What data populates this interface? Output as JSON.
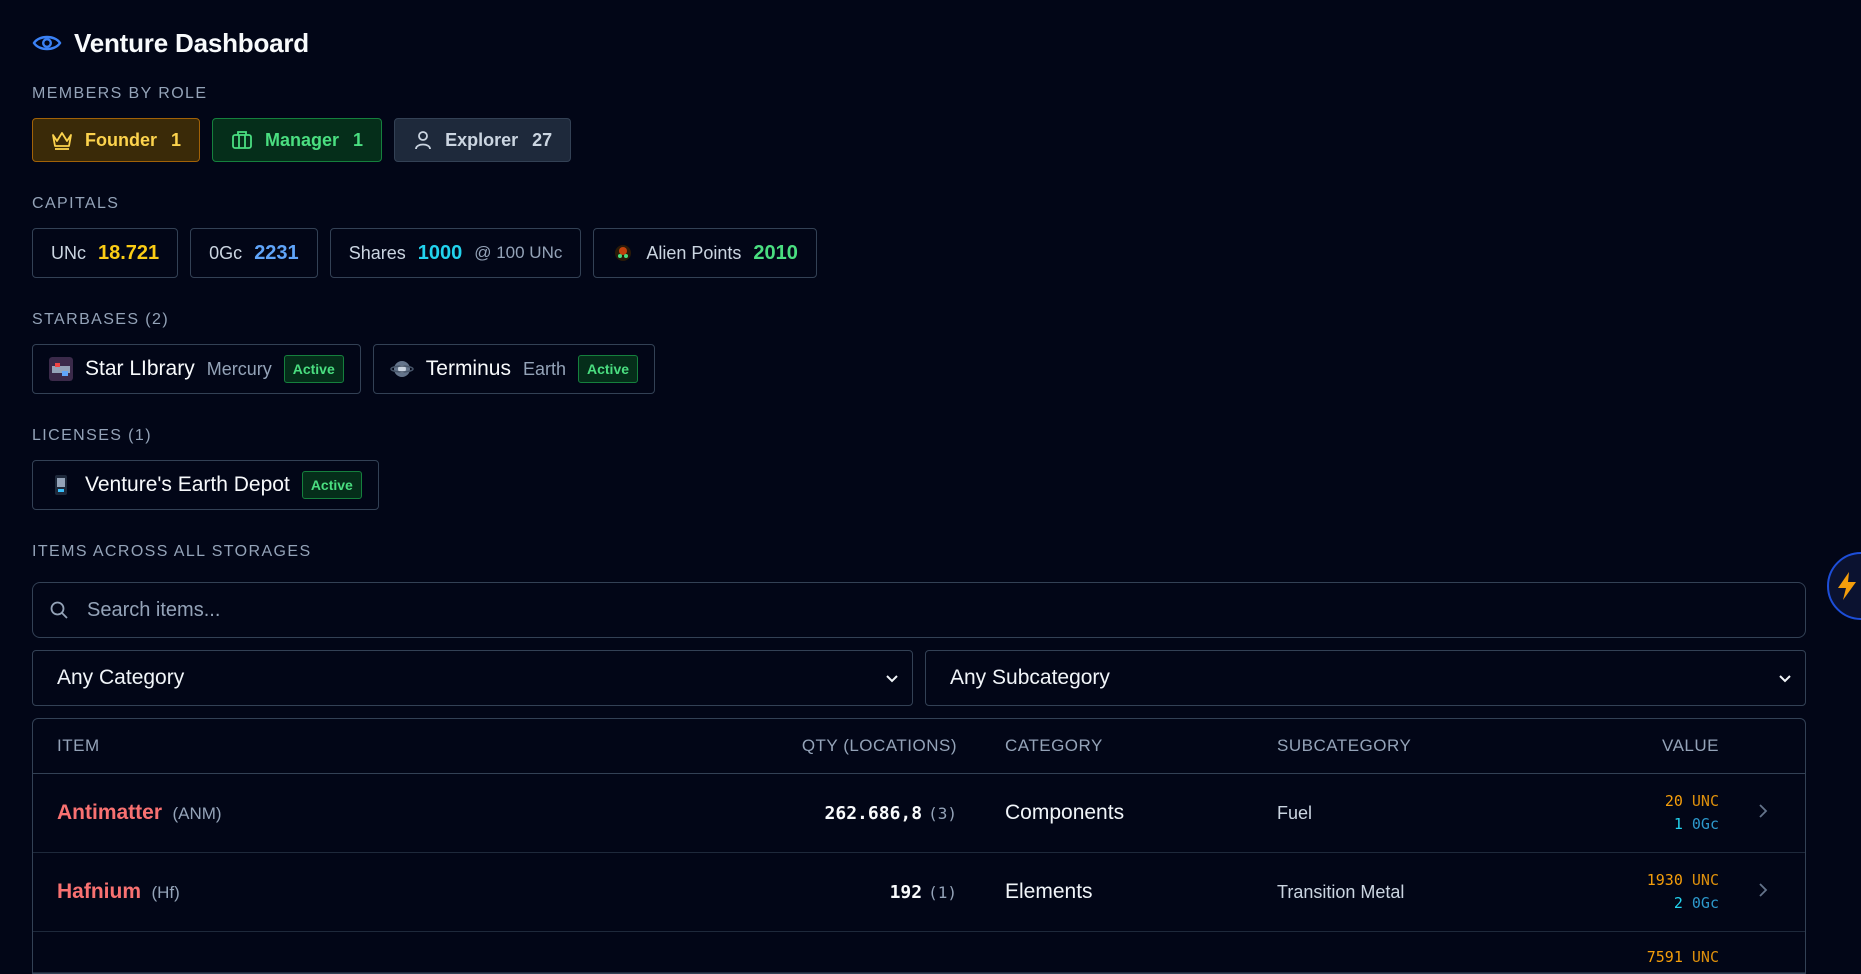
{
  "header": {
    "title": "Venture Dashboard",
    "icon": "eye-icon"
  },
  "members": {
    "label": "MEMBERS BY ROLE",
    "roles": [
      {
        "name": "Founder",
        "count": "1",
        "icon": "crown-icon"
      },
      {
        "name": "Manager",
        "count": "1",
        "icon": "briefcase-icon"
      },
      {
        "name": "Explorer",
        "count": "27",
        "icon": "user-icon"
      }
    ]
  },
  "capitals": {
    "label": "CAPITALS",
    "items": [
      {
        "name": "UNc",
        "value": "18.721",
        "color": "#facc15"
      },
      {
        "name": "0Gc",
        "value": "2231",
        "color": "#60a5fa"
      },
      {
        "name": "Shares",
        "value": "1000",
        "note": "@ 100 UNc",
        "color": "#22d3ee"
      },
      {
        "name": "Alien Points",
        "value": "2010",
        "color": "#4ade80"
      }
    ]
  },
  "starbases": {
    "label": "STARBASES (2)",
    "items": [
      {
        "name": "Star LIbrary",
        "location": "Mercury",
        "status": "Active"
      },
      {
        "name": "Terminus",
        "location": "Earth",
        "status": "Active"
      }
    ]
  },
  "licenses": {
    "label": "LICENSES (1)",
    "items": [
      {
        "name": "Venture's Earth Depot",
        "status": "Active"
      }
    ]
  },
  "storage": {
    "label": "ITEMS ACROSS ALL STORAGES",
    "search_placeholder": "Search items...",
    "category_select": "Any Category",
    "subcategory_select": "Any Subcategory",
    "columns": {
      "item": "ITEM",
      "qty": "QTY (LOCATIONS)",
      "category": "CATEGORY",
      "subcategory": "SUBCATEGORY",
      "value": "VALUE"
    },
    "rows": [
      {
        "name": "Antimatter",
        "symbol": "(ANM)",
        "qty": "262.686,8",
        "locations": "(3)",
        "category": "Components",
        "subcategory": "Fuel",
        "unc": "20",
        "unc_label": "UNC",
        "ogc": "1",
        "ogc_label": "0Gc"
      },
      {
        "name": "Hafnium",
        "symbol": "(Hf)",
        "qty": "192",
        "locations": "(1)",
        "category": "Elements",
        "subcategory": "Transition Metal",
        "unc": "1930",
        "unc_label": "UNC",
        "ogc": "2",
        "ogc_label": "0Gc"
      }
    ],
    "partial_row": {
      "unc": "7591",
      "unc_label": "UNC"
    }
  },
  "fab": {
    "icon": "lightning-icon",
    "color": "#f59e0b"
  }
}
